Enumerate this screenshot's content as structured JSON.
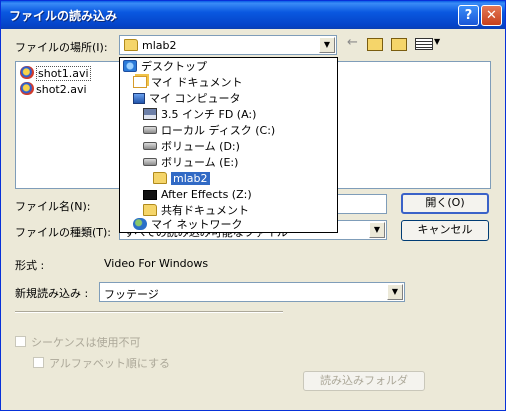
{
  "window": {
    "title": "ファイルの読み込み"
  },
  "location": {
    "label": "ファイルの場所(I):",
    "value": "mlab2"
  },
  "files": [
    {
      "name": "shot1.avi",
      "selected": true
    },
    {
      "name": "shot2.avi",
      "selected": false
    }
  ],
  "dropdown": {
    "items": [
      {
        "label": "デスクトップ",
        "icon": "desktop-icon"
      },
      {
        "label": "マイ ドキュメント",
        "icon": "my-documents-icon"
      },
      {
        "label": "マイ コンピュータ",
        "icon": "my-computer-icon"
      },
      {
        "label": "3.5 インチ FD (A:)",
        "icon": "floppy-drive-icon"
      },
      {
        "label": "ローカル ディスク (C:)",
        "icon": "hard-drive-icon"
      },
      {
        "label": "ボリューム (D:)",
        "icon": "hard-drive-icon"
      },
      {
        "label": "ボリューム (E:)",
        "icon": "hard-drive-icon"
      },
      {
        "label": "mlab2",
        "icon": "folder-icon"
      },
      {
        "label": "After Effects (Z:)",
        "icon": "network-drive-icon"
      },
      {
        "label": "共有ドキュメント",
        "icon": "folder-icon"
      },
      {
        "label": "マイ ネットワーク",
        "icon": "my-network-icon"
      }
    ]
  },
  "filename": {
    "label": "ファイル名(N):",
    "value": ""
  },
  "filetype": {
    "label": "ファイルの種類(T):",
    "value": "すべての読み込み可能なファイル"
  },
  "buttons": {
    "open": "開く(O)",
    "cancel": "キャンセル",
    "import_folder": "読み込みフォルダ"
  },
  "format": {
    "label": "形式 :",
    "value": "Video For Windows"
  },
  "import_as": {
    "label": "新規読み込み :",
    "value": "フッテージ"
  },
  "sequence": {
    "label": "シーケンスは使用不可"
  },
  "alphabetical": {
    "label": "アルファベット順にする"
  },
  "colors": {
    "title_bar": "#0a58e0",
    "selection": "#316ac5",
    "dialog_bg": "#ece9d8"
  }
}
